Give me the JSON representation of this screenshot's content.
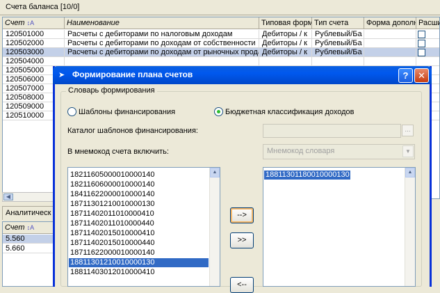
{
  "bg": {
    "title": "Счета баланса [10/0]",
    "grid_columns": [
      "Счет",
      "Наименование",
      "Типовая форм",
      "Тип счета",
      "Форма дополн",
      "Расши"
    ],
    "rows": [
      {
        "code": "120501000",
        "name": "Расчеты с дебиторами по налоговым доходам",
        "form": "Дебиторы / к",
        "type": "Рублевый/Ба"
      },
      {
        "code": "120502000",
        "name": "Расчеты с дебиторами по доходам от собственности",
        "form": "Дебиторы / к",
        "type": "Рублевый/Ба"
      },
      {
        "code": "120503000",
        "name": "Расчеты с дебиторами по доходам от рыночных прода",
        "form": "Дебиторы / к",
        "type": "Рублевый/Ба"
      },
      {
        "code": "120504000",
        "name": "",
        "form": "",
        "type": ""
      },
      {
        "code": "120505000",
        "name": "",
        "form": "",
        "type": ""
      },
      {
        "code": "120506000",
        "name": "",
        "form": "",
        "type": ""
      },
      {
        "code": "120507000",
        "name": "",
        "form": "",
        "type": ""
      },
      {
        "code": "120508000",
        "name": "",
        "form": "",
        "type": ""
      },
      {
        "code": "120509000",
        "name": "",
        "form": "",
        "type": ""
      },
      {
        "code": "120510000",
        "name": "",
        "form": "",
        "type": ""
      }
    ],
    "tab2_label": "Аналитическ",
    "grid2_column": "Счет",
    "grid2_rows": [
      "5.560",
      "5.660"
    ]
  },
  "dialog": {
    "title": "Формирование плана счетов",
    "help_label": "?",
    "close_label": "✕",
    "group_label": "Словарь формирования",
    "radio_templates": "Шаблоны финансирования",
    "radio_budget": "Бюджетная классификация доходов",
    "catalog_label": "Каталог шаблонов финансирования:",
    "catalog_button": "...",
    "mnemo_label": "В мнемокод счета включить:",
    "mnemo_value": "Мнемокод словаря",
    "left_list": [
      "18211605000010000140",
      "18211606000010000140",
      "18411622000010000140",
      "18711301210010000130",
      "18711402011010000410",
      "18711402011010000440",
      "18711402015010000410",
      "18711402015010000440",
      "18711622000010000140",
      "18811301210010000130",
      "18811403012010000410"
    ],
    "left_selected_index": 9,
    "right_list": [
      "18811301180010000130"
    ],
    "btn_move": "-->",
    "btn_move_all": ">>",
    "btn_back": "<--"
  }
}
